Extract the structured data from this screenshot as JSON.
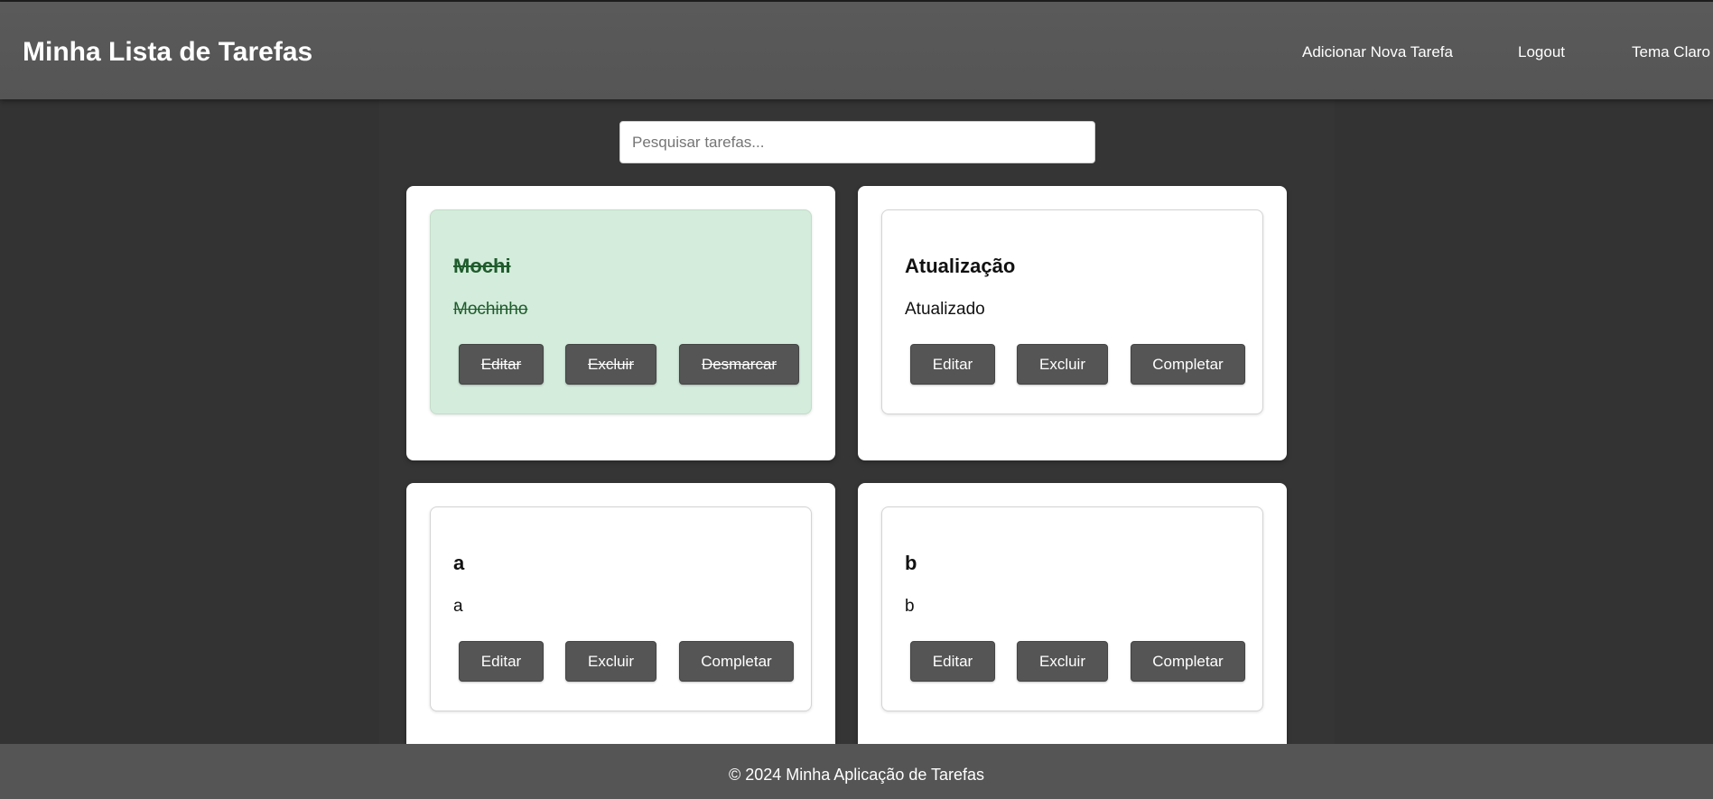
{
  "header": {
    "title": "Minha Lista de Tarefas",
    "nav": {
      "add_task": "Adicionar Nova Tarefa",
      "logout": "Logout",
      "theme": "Tema Claro"
    }
  },
  "search": {
    "placeholder": "Pesquisar tarefas...",
    "value": ""
  },
  "tasks": [
    {
      "title": "Mochi",
      "description": "Mochinho",
      "completed": true,
      "edit_label": "Editar",
      "delete_label": "Excluir",
      "toggle_label": "Desmarcar"
    },
    {
      "title": "Atualização",
      "description": "Atualizado",
      "completed": false,
      "edit_label": "Editar",
      "delete_label": "Excluir",
      "toggle_label": "Completar"
    },
    {
      "title": "a",
      "description": "a",
      "completed": false,
      "edit_label": "Editar",
      "delete_label": "Excluir",
      "toggle_label": "Completar"
    },
    {
      "title": "b",
      "description": "b",
      "completed": false,
      "edit_label": "Editar",
      "delete_label": "Excluir",
      "toggle_label": "Completar"
    }
  ],
  "footer": {
    "text": "© 2024 Minha Aplicação de Tarefas"
  },
  "colors": {
    "background": "#333333",
    "header": "#555555",
    "button": "#555555",
    "completed_card": "#d4ecdc",
    "completed_text": "#1f5c2c"
  }
}
